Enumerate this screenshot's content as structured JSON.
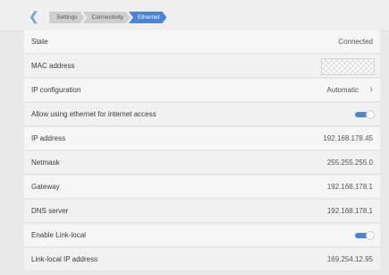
{
  "nav": {
    "breadcrumbs": [
      "Settings",
      "Connectivity",
      "Ethernet"
    ]
  },
  "rows": [
    {
      "label": "State",
      "value": "Connected"
    },
    {
      "label": "MAC address",
      "value": ""
    },
    {
      "label": "IP configuration",
      "value": "Automatic"
    },
    {
      "label": "Allow using ethernet for internet access",
      "toggle": true
    },
    {
      "label": "IP address",
      "value": "192.168.178.45"
    },
    {
      "label": "Netmask",
      "value": "255.255.255.0"
    },
    {
      "label": "Gateway",
      "value": "192.168.178.1"
    },
    {
      "label": "DNS server",
      "value": "192.168.178.1"
    },
    {
      "label": "Enable Link-local",
      "toggle": true
    },
    {
      "label": "Link-local IP address",
      "value": "169.254.12.95"
    }
  ],
  "colors": {
    "accent": "#4a84d8",
    "row_bg": "#f6f6f6",
    "page_bg": "#e9e9e9"
  },
  "icons": {
    "back": "chevron-left-icon",
    "ip_config_chevron": "chevron-right-icon"
  }
}
